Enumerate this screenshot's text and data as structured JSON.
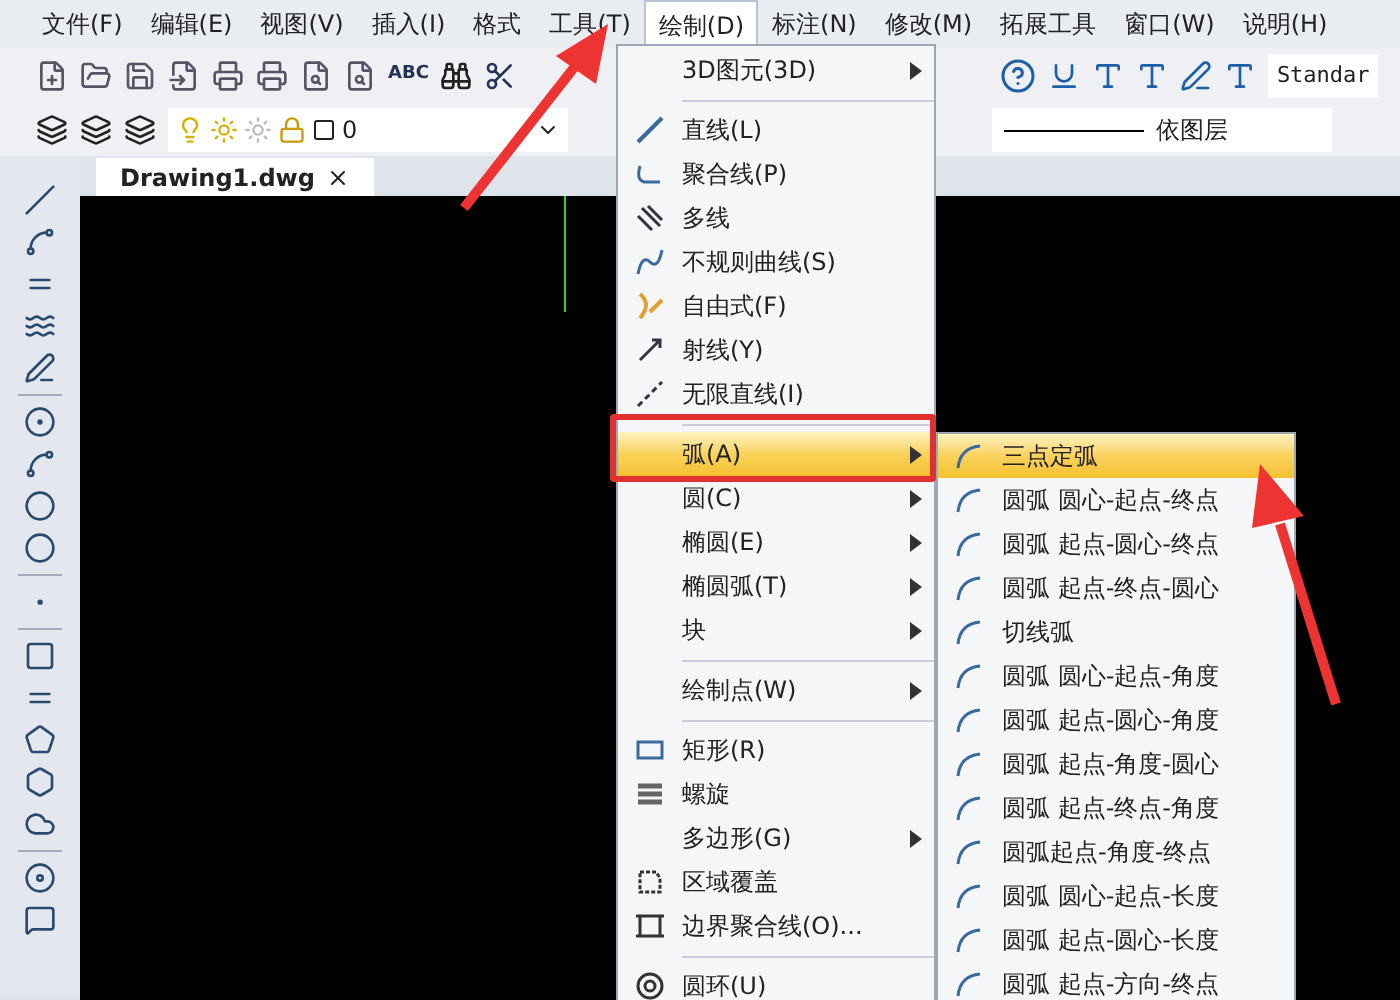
{
  "menu_bar": [
    {
      "label": "文件(F)",
      "selected": false
    },
    {
      "label": "编辑(E)",
      "selected": false
    },
    {
      "label": "视图(V)",
      "selected": false
    },
    {
      "label": "插入(I)",
      "selected": false
    },
    {
      "label": "格式",
      "selected": false
    },
    {
      "label": "工具(T)",
      "selected": false
    },
    {
      "label": "绘制(D)",
      "selected": true
    },
    {
      "label": "标注(N)",
      "selected": false
    },
    {
      "label": "修改(M)",
      "selected": false
    },
    {
      "label": "拓展工具",
      "selected": false
    },
    {
      "label": "窗口(W)",
      "selected": false
    },
    {
      "label": "说明(H)",
      "selected": false
    }
  ],
  "toolbar": {
    "spell_label": "ABC",
    "text_style": "Standar"
  },
  "layer_bar": {
    "layer": "0",
    "linetype": "依图层"
  },
  "tabs": [
    {
      "label": "Drawing1.dwg",
      "selected": true
    }
  ],
  "draw_menu": [
    {
      "kind": "submenu",
      "label": "3D图元(3D)",
      "selected": false
    },
    {
      "kind": "separator"
    },
    {
      "kind": "command",
      "label": "直线(L)",
      "selected": false
    },
    {
      "kind": "command",
      "label": "聚合线(P)",
      "selected": false
    },
    {
      "kind": "command",
      "label": "多线",
      "selected": false
    },
    {
      "kind": "command",
      "label": "不规则曲线(S)",
      "selected": false
    },
    {
      "kind": "command",
      "label": "自由式(F)",
      "selected": false
    },
    {
      "kind": "command",
      "label": "射线(Y)",
      "selected": false
    },
    {
      "kind": "command",
      "label": "无限直线(I)",
      "selected": false
    },
    {
      "kind": "separator"
    },
    {
      "kind": "submenu",
      "label": "弧(A)",
      "selected": true
    },
    {
      "kind": "submenu",
      "label": "圆(C)",
      "selected": false
    },
    {
      "kind": "submenu",
      "label": "椭圆(E)",
      "selected": false
    },
    {
      "kind": "submenu",
      "label": "椭圆弧(T)",
      "selected": false
    },
    {
      "kind": "submenu",
      "label": "块",
      "selected": false
    },
    {
      "kind": "separator"
    },
    {
      "kind": "submenu",
      "label": "绘制点(W)",
      "selected": false
    },
    {
      "kind": "separator"
    },
    {
      "kind": "command",
      "label": "矩形(R)",
      "selected": false
    },
    {
      "kind": "command",
      "label": "螺旋",
      "selected": false
    },
    {
      "kind": "submenu",
      "label": "多边形(G)",
      "selected": false
    },
    {
      "kind": "command",
      "label": "区域覆盖",
      "selected": false
    },
    {
      "kind": "command",
      "label": "边界聚合线(O)...",
      "selected": false
    },
    {
      "kind": "separator"
    },
    {
      "kind": "command",
      "label": "圆环(U)",
      "selected": false
    }
  ],
  "arc_submenu": [
    {
      "label": "三点定弧",
      "selected": true
    },
    {
      "label": "圆弧 圆心-起点-终点",
      "selected": false
    },
    {
      "label": "圆弧 起点-圆心-终点",
      "selected": false
    },
    {
      "label": "圆弧 起点-终点-圆心",
      "selected": false
    },
    {
      "label": "切线弧",
      "selected": false
    },
    {
      "label": "圆弧 圆心-起点-角度",
      "selected": false
    },
    {
      "label": "圆弧 起点-圆心-角度",
      "selected": false
    },
    {
      "label": "圆弧 起点-角度-圆心",
      "selected": false
    },
    {
      "label": "圆弧 起点-终点-角度",
      "selected": false
    },
    {
      "label": "圆弧起点-角度-终点",
      "selected": false
    },
    {
      "label": "圆弧 圆心-起点-长度",
      "selected": false
    },
    {
      "label": "圆弧 起点-圆心-长度",
      "selected": false
    },
    {
      "label": "圆弧 起点-方向-终点",
      "selected": false
    }
  ]
}
